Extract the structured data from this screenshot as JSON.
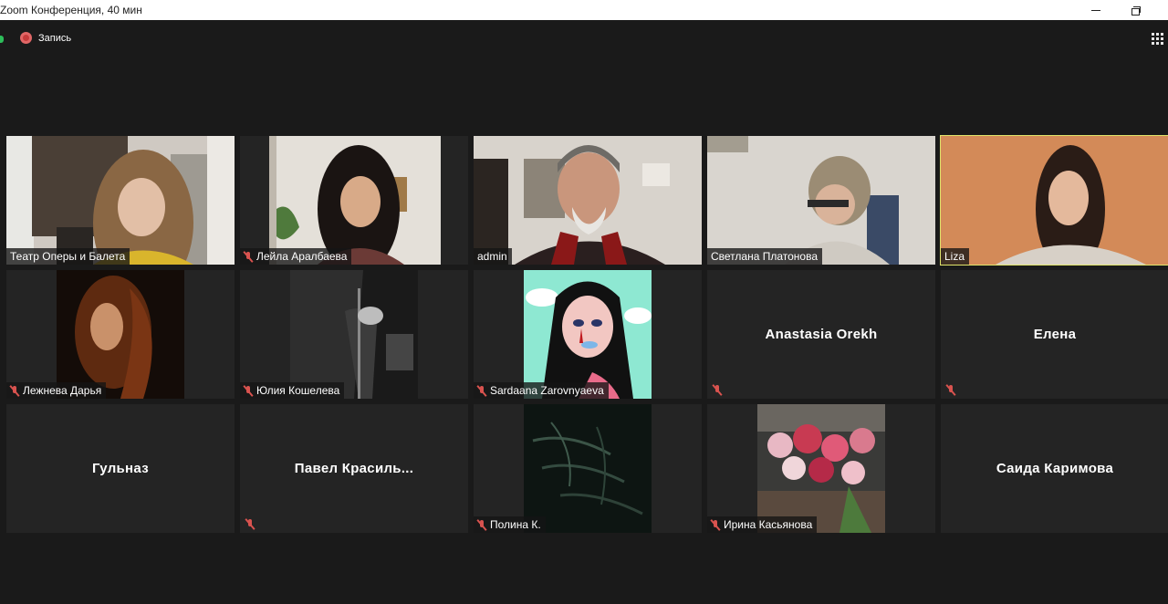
{
  "window": {
    "title": "Zoom Конференция, 40 мин"
  },
  "topbar": {
    "record_label": "Запись"
  },
  "colors": {
    "active_speaker": "#dfe36a",
    "muted_mic": "#d9534f",
    "record_dot": "#c43b3b",
    "background": "#1a1a1a",
    "tile_background": "#242424"
  },
  "participants": [
    {
      "name": "Театр Оперы и Балета",
      "muted": false,
      "video": true,
      "active": false
    },
    {
      "name": "Лейла Аралбаева",
      "muted": true,
      "video": true,
      "active": false
    },
    {
      "name": "admin",
      "muted": false,
      "video": true,
      "active": false
    },
    {
      "name": "Светлана Платонова",
      "muted": false,
      "video": true,
      "active": false
    },
    {
      "name": "Liza",
      "muted": false,
      "video": true,
      "active": true
    },
    {
      "name": "Лежнева Дарья",
      "muted": true,
      "video": true,
      "active": false
    },
    {
      "name": "Юлия Кошелева",
      "muted": true,
      "video": true,
      "active": false
    },
    {
      "name": "Sardaana Zarovnyaeva",
      "muted": true,
      "video": true,
      "active": false
    },
    {
      "name": "Anastasia  Orekh",
      "muted": true,
      "video": false,
      "active": false
    },
    {
      "name": "Елена",
      "muted": true,
      "video": false,
      "active": false
    },
    {
      "name": "Гульназ",
      "muted": false,
      "video": false,
      "active": false
    },
    {
      "name": "Павел  Красиль...",
      "muted": true,
      "video": false,
      "active": false
    },
    {
      "name": "Полина К.",
      "muted": true,
      "video": true,
      "active": false
    },
    {
      "name": "Ирина Касьянова",
      "muted": true,
      "video": true,
      "active": false
    },
    {
      "name": "Саида Каримова",
      "muted": false,
      "video": false,
      "active": false
    }
  ]
}
